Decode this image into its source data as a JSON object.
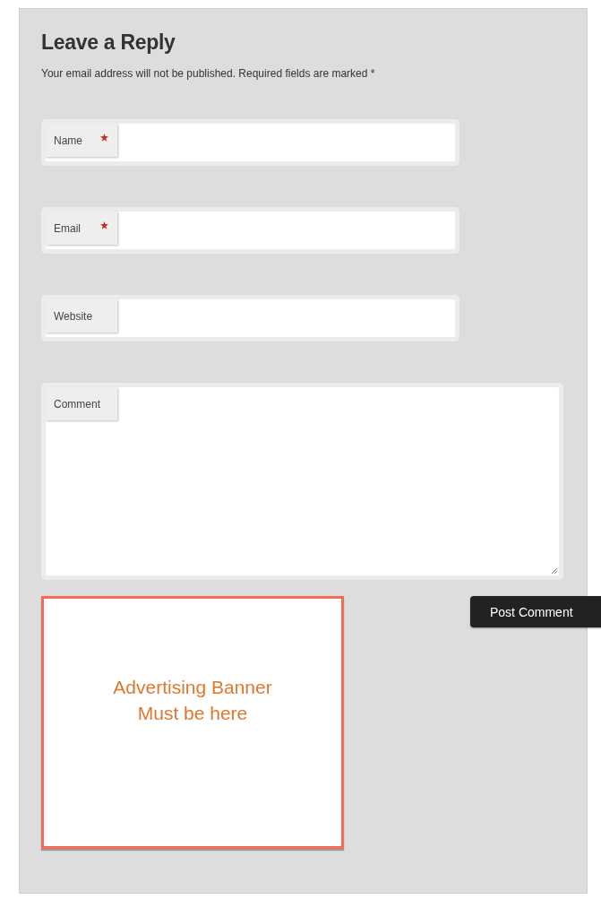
{
  "title": "Leave a Reply",
  "note": "Your email address will not be published. Required fields are marked *",
  "fields": [
    {
      "kind": "line",
      "label": "Name",
      "required": true
    },
    {
      "kind": "line",
      "label": "Email",
      "required": true
    },
    {
      "kind": "line",
      "label": "Website",
      "required": false
    },
    {
      "kind": "area",
      "label": "Comment",
      "required": false
    }
  ],
  "submit": "Post Comment",
  "banner": {
    "lines": [
      "Advertising Banner",
      "Must be here"
    ]
  }
}
